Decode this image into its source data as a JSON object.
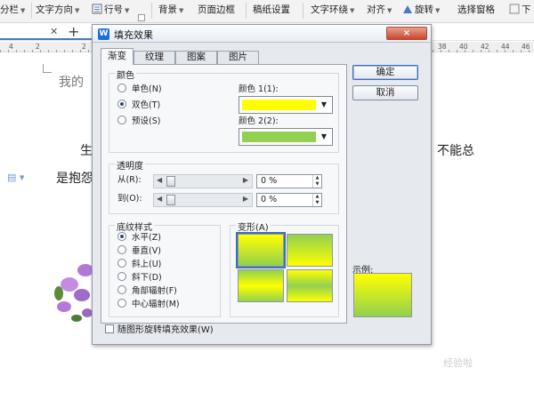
{
  "colors": {
    "color1": "#ffff00",
    "color2": "#92d050",
    "accent": "#3b6fb6"
  },
  "ribbon": {
    "items": [
      {
        "label": "分栏",
        "icon": "columns-icon"
      },
      {
        "label": "文字方向",
        "icon": "text-direction-icon"
      },
      {
        "label": "行号",
        "icon": "line-number-icon"
      },
      {
        "label": "背景",
        "icon": "background-icon"
      },
      {
        "label": "页面边框",
        "icon": "page-border-icon"
      },
      {
        "label": "稿纸设置",
        "icon": "manuscript-icon"
      },
      {
        "label": "文字环绕",
        "icon": "text-wrap-icon"
      },
      {
        "label": "对齐",
        "icon": "align-icon"
      },
      {
        "label": "旋转",
        "icon": "rotate-icon"
      },
      {
        "label": "选择窗格",
        "icon": "selection-pane-icon"
      },
      {
        "label": "下",
        "icon": "move-down-icon"
      }
    ]
  },
  "ruler": {
    "numbers": [
      "4",
      "2",
      "2",
      "38",
      "40",
      "42",
      "44",
      "46"
    ]
  },
  "document": {
    "title_fragment": "我的",
    "line1_left": "生",
    "line1_right": "不能总",
    "line2_left": "是抱怨"
  },
  "watermark": "经验啦",
  "dialog": {
    "title": "填充效果",
    "close_label": "×",
    "tabs": [
      "渐变",
      "纹理",
      "图案",
      "图片"
    ],
    "active_tab": 0,
    "colors_group": {
      "title": "颜色",
      "options": [
        "单色(N)",
        "双色(T)",
        "预设(S)"
      ],
      "selected": 1,
      "color1_label": "颜色 1(1):",
      "color2_label": "颜色 2(2):"
    },
    "transparency_group": {
      "title": "透明度",
      "from_label": "从(R):",
      "to_label": "到(O):",
      "from_value": "0 %",
      "to_value": "0 %"
    },
    "shading_group": {
      "title": "底纹样式",
      "options": [
        "水平(Z)",
        "垂直(V)",
        "斜上(U)",
        "斜下(D)",
        "角部辐射(F)",
        "中心辐射(M)"
      ],
      "selected": 0
    },
    "variants_group": {
      "title": "变形(A)",
      "selected": 0
    },
    "ok_label": "确定",
    "cancel_label": "取消",
    "sample_label": "示例:",
    "rotate_checkbox_label": "随图形旋转填充效果(W)",
    "rotate_checked": false
  }
}
